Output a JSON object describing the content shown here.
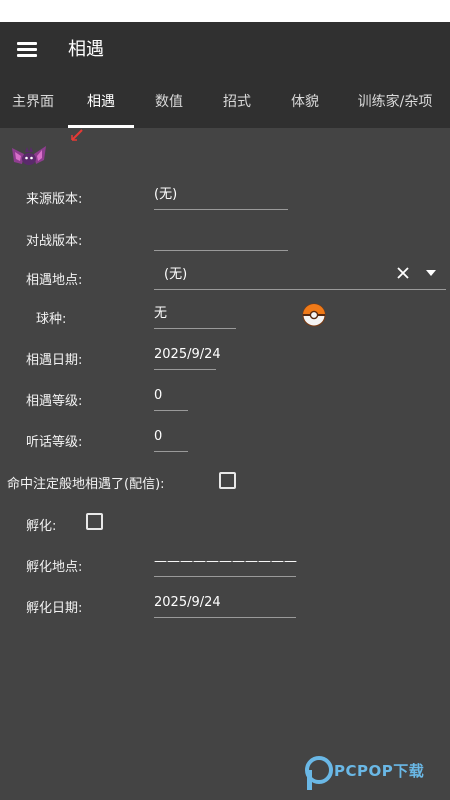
{
  "app": {
    "title": "相遇"
  },
  "tabs": [
    "主界面",
    "相遇",
    "数值",
    "招式",
    "体貌",
    "训练家/杂项"
  ],
  "form": {
    "origin_game": {
      "label": "来源版本:",
      "value": "(无)"
    },
    "battle_version": {
      "label": "对战版本:",
      "value": ""
    },
    "met_location": {
      "label": "相遇地点:",
      "value": "(无)"
    },
    "ball": {
      "label": "球种:",
      "value": "无"
    },
    "met_date": {
      "label": "相遇日期:",
      "value": "2025/9/24"
    },
    "met_level": {
      "label": "相遇等级:",
      "value": "0"
    },
    "obedience_level": {
      "label": "听话等级:",
      "value": "0"
    },
    "fateful_encounter": {
      "label": "命中注定般地相遇了(配信):",
      "checked": false
    },
    "egg": {
      "label": "孵化:",
      "checked": false
    },
    "egg_location": {
      "label": "孵化地点:",
      "value": "———————————"
    },
    "egg_date": {
      "label": "孵化日期:",
      "value": "2025/9/24"
    }
  },
  "icons": {
    "menu": "hamburger-menu-icon",
    "sprite": "pokemon-sprite-icon",
    "clear": "close-icon",
    "dropdown": "chevron-down-icon",
    "ball": "poke-ball-icon"
  },
  "watermark": {
    "text": "PCPOP下载"
  },
  "colors": {
    "appbar": "#303030",
    "content": "#444444",
    "watermark": "#6ab8e6"
  }
}
